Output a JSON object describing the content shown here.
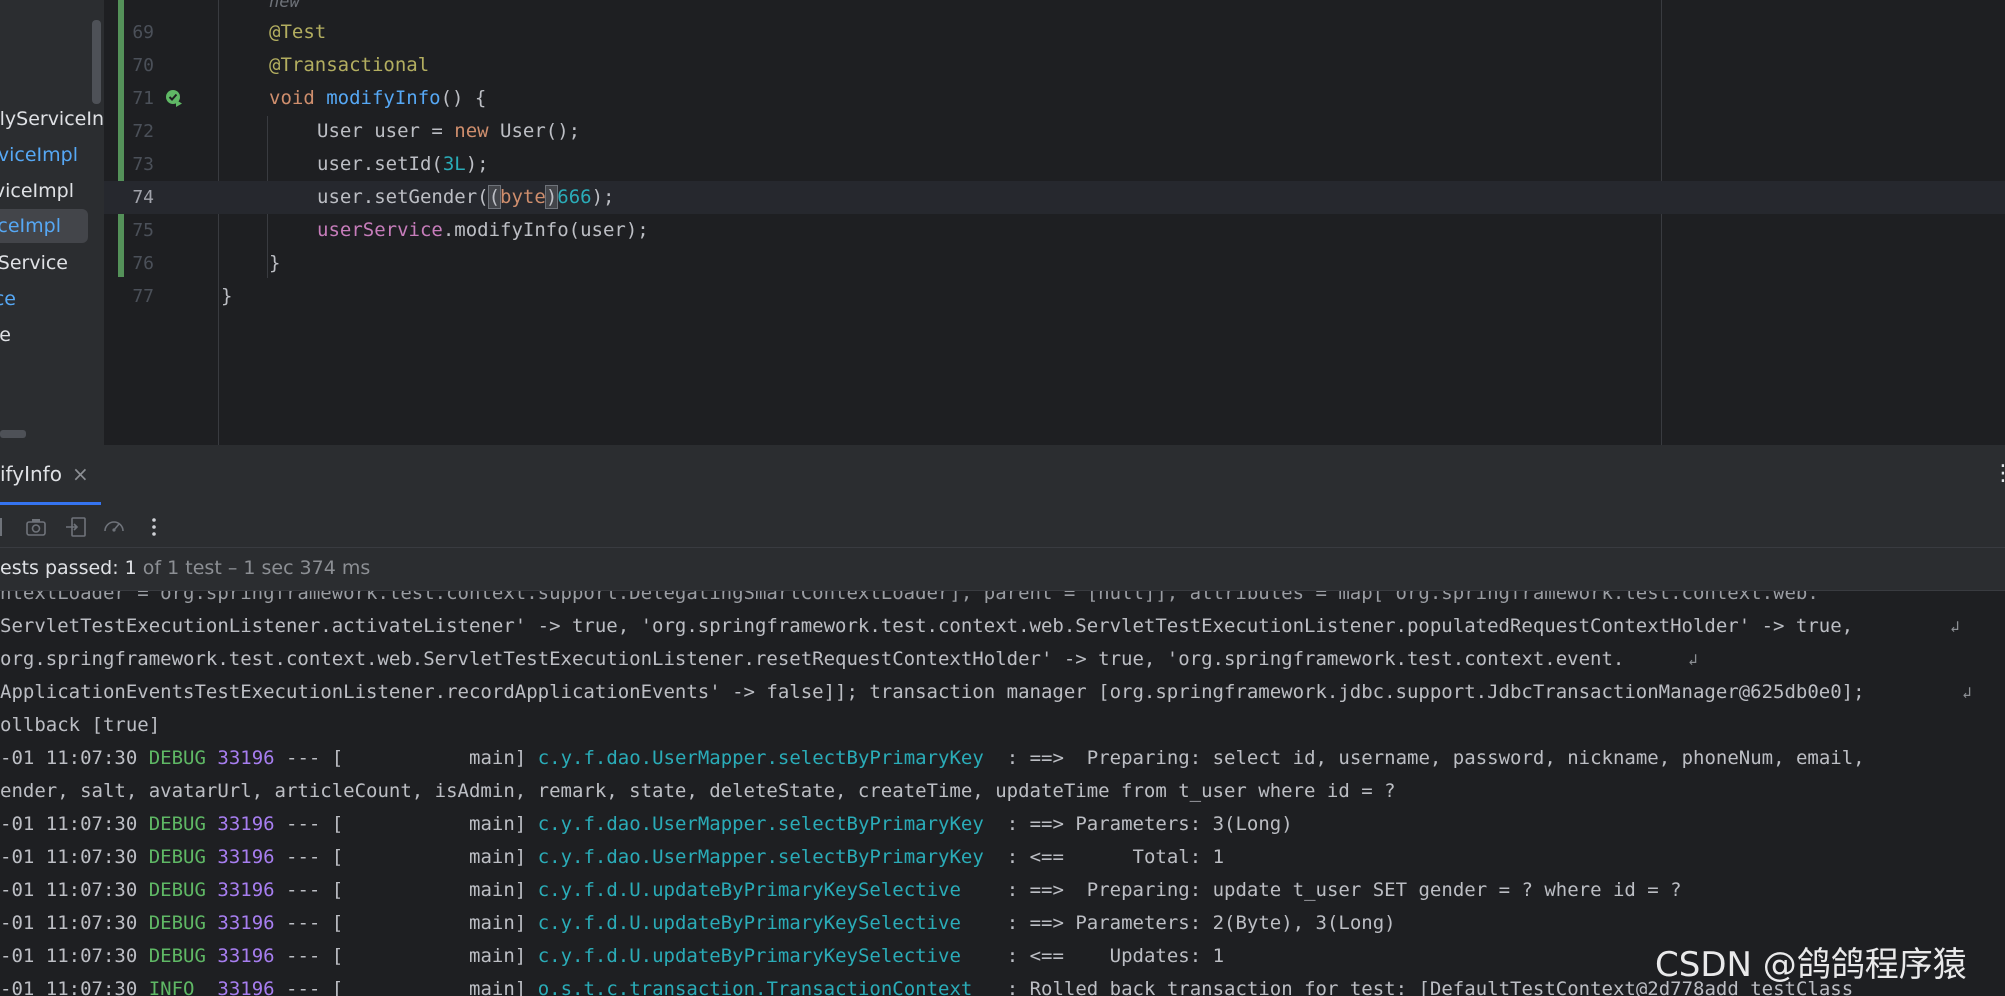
{
  "sidebar": {
    "items": [
      {
        "label": "plyServiceIn",
        "color": "#dfe1e5"
      },
      {
        "label": "rviceImpl",
        "color": "#56a8f5"
      },
      {
        "label": "viceImpl",
        "color": "#dfe1e5"
      },
      {
        "label": "iceImpl",
        "color": "#56a8f5"
      },
      {
        "label": "Service",
        "color": "#dfe1e5"
      },
      {
        "label": "ce",
        "color": "#56a8f5"
      },
      {
        "label": "e",
        "color": "#dfe1e5"
      }
    ]
  },
  "editor": {
    "hint_new": "new",
    "lines": [
      {
        "num": "69"
      },
      {
        "num": "70"
      },
      {
        "num": "71"
      },
      {
        "num": "72"
      },
      {
        "num": "73"
      },
      {
        "num": "74"
      },
      {
        "num": "75"
      },
      {
        "num": "76"
      },
      {
        "num": "77"
      }
    ],
    "tokens": {
      "ann_test": "@Test",
      "ann_tx": "@Transactional",
      "kw_void": "void",
      "method_name": "modifyInfo",
      "sig_rest": "() {",
      "l72_type": "User user = ",
      "kw_new": "new",
      "l72_rest": " User();",
      "l73_a": "user.setId(",
      "l73_num": "3L",
      "l73_b": ");",
      "l74_a": "user.setGender(",
      "l74_paren": "(",
      "kw_byte": "byte",
      "l74_paren2": ")",
      "l74_num": "666",
      "l74_b": ");",
      "l75_field": "userService",
      "l75_rest": ".modifyInfo(user);",
      "close_inner": "}",
      "close_outer": "}"
    }
  },
  "toolwindow": {
    "tab_label": "ifyInfo",
    "tab_close": "×",
    "more": "⋮",
    "status_passed": "ests passed: 1",
    "status_rest": " of 1 test – 1 sec 374 ms"
  },
  "console": {
    "lines": [
      {
        "text": "ntextLoader = org.springframework.test.context.support.DelegatingSmartContextLoader], parent = [null]], attributes = map['org.springframework.test.context.web."
      },
      {
        "text": "ServletTestExecutionListener.activateListener' -> true, 'org.springframework.test.context.web.ServletTestExecutionListener.populatedRequestContextHolder' -> true, ",
        "wrap": true
      },
      {
        "text": "org.springframework.test.context.web.ServletTestExecutionListener.resetRequestContextHolder' -> true, 'org.springframework.test.context.event.",
        "wrap": true
      },
      {
        "text": "ApplicationEventsTestExecutionListener.recordApplicationEvents' -> false]]; transaction manager [org.springframework.jdbc.support.JdbcTransactionManager@625db0e0]; ",
        "wrap": true
      },
      {
        "text": "ollback [true]"
      }
    ],
    "log": [
      {
        "time": "-01 11:07:30 ",
        "level": "DEBUG",
        "pid": "33196",
        "mid": " --- [           main] ",
        "logger": "c.y.f.dao.UserMapper.selectByPrimaryKey",
        "msg": "  : ==>  Preparing: select id, username, password, nickname, phoneNum, email,"
      },
      {
        "cont": "ender, salt, avatarUrl, articleCount, isAdmin, remark, state, deleteState, createTime, updateTime from t_user where id = ?"
      },
      {
        "time": "-01 11:07:30 ",
        "level": "DEBUG",
        "pid": "33196",
        "mid": " --- [           main] ",
        "logger": "c.y.f.dao.UserMapper.selectByPrimaryKey",
        "msg": "  : ==> Parameters: 3(Long)"
      },
      {
        "time": "-01 11:07:30 ",
        "level": "DEBUG",
        "pid": "33196",
        "mid": " --- [           main] ",
        "logger": "c.y.f.dao.UserMapper.selectByPrimaryKey",
        "msg": "  : <==      Total: 1"
      },
      {
        "time": "-01 11:07:30 ",
        "level": "DEBUG",
        "pid": "33196",
        "mid": " --- [           main] ",
        "logger": "c.y.f.d.U.updateByPrimaryKeySelective",
        "msg": "    : ==>  Preparing: update t_user SET gender = ? where id = ?"
      },
      {
        "time": "-01 11:07:30 ",
        "level": "DEBUG",
        "pid": "33196",
        "mid": " --- [           main] ",
        "logger": "c.y.f.d.U.updateByPrimaryKeySelective",
        "msg": "    : ==> Parameters: 2(Byte), 3(Long)"
      },
      {
        "time": "-01 11:07:30 ",
        "level": "DEBUG",
        "pid": "33196",
        "mid": " --- [           main] ",
        "logger": "c.y.f.d.U.updateByPrimaryKeySelective",
        "msg": "    : <==    Updates: 1"
      },
      {
        "time": "-01 11:07:30 ",
        "level": "INFO ",
        "pid": "33196",
        "mid": " --- [           main] ",
        "logger": "o.s.t.c.transaction.TransactionContext",
        "msg": "   : Rolled back transaction for test: [DefaultTestContext@2d778add testClass"
      }
    ]
  },
  "watermark": "CSDN @鸽鸽程序猿"
}
